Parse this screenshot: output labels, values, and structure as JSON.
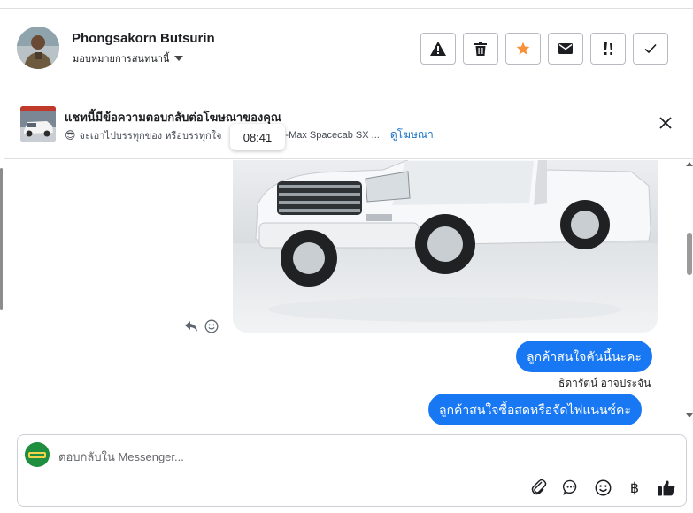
{
  "header": {
    "contact_name": "Phongsakorn Butsurin",
    "assign_label": "มอบหมายการสนทนานี้",
    "actions": [
      {
        "name": "report-spam",
        "icon": "warning-icon"
      },
      {
        "name": "delete",
        "icon": "trash-icon"
      },
      {
        "name": "star",
        "icon": "star-icon",
        "color": "#f7923a"
      },
      {
        "name": "mark-unread",
        "icon": "envelope-icon"
      },
      {
        "name": "follow-up",
        "icon": "important-icon"
      },
      {
        "name": "mark-done",
        "icon": "check-icon"
      }
    ]
  },
  "ad_banner": {
    "title": "แชทนี้มีข้อความตอบกลับต่อโฆษณาของคุณ",
    "emoji": "😎",
    "subtitle": "จะเอาไปบรรทุกของ หรือบรรทุกใจ",
    "ad_name": "D-Max Spacecab SX ...",
    "view_ad_link": "ดูโฆษณา",
    "time_tooltip": "08:41"
  },
  "messages": [
    {
      "type": "image",
      "description_icon": "car-photo"
    },
    {
      "type": "outgoing",
      "text": "ลูกค้าสนใจคันนี้นะคะ",
      "sender": "ธิดารัตน์ อาจประจัน"
    },
    {
      "type": "outgoing",
      "text": "ลูกค้าสนใจซื้อสดหรือจัดไฟแนนซ์คะ"
    }
  ],
  "composer": {
    "placeholder": "ตอบกลับใน Messenger...",
    "tools": [
      "paperclip-icon",
      "chat-bubble-icon",
      "emoji-icon",
      "baht-icon",
      "thumbs-up-icon"
    ],
    "baht_symbol": "฿"
  },
  "colors": {
    "accent": "#1877f2",
    "link": "#1a73c9",
    "star": "#f7923a"
  }
}
